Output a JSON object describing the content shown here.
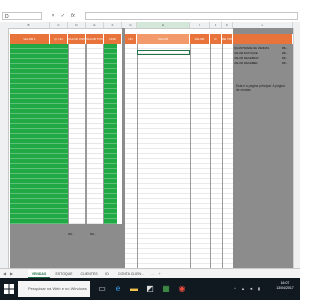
{
  "formula_bar": {
    "name_box": "D",
    "cancel": "×",
    "enter": "✓",
    "fx": "fx",
    "formula": ""
  },
  "column_headers": [
    "B",
    "C",
    "D",
    "E",
    "F",
    "G",
    "H",
    "I",
    "J",
    "K",
    "L"
  ],
  "left_headers": [
    "VALOR 1",
    "Q. UN",
    "VALOR UNIT",
    "VALOR TOTAL",
    "UND"
  ],
  "right_headers": [
    "UN",
    "VALOR",
    "VALOR",
    "D",
    "DE TOTAL"
  ],
  "totals_row": {
    "left": "R$ -",
    "right": "R$ -"
  },
  "info_panel": [
    {
      "label": "QUANTIDADE DE VENDAS",
      "value": "R$ -"
    },
    {
      "label": "VALOR ESTOQUE",
      "value": "R$ -"
    },
    {
      "label": "VALOR RECEBIDO",
      "value": "R$ -"
    },
    {
      "label": "VALOR RECEBER",
      "value": "R$ -"
    }
  ],
  "note": "Esta é a página principal. A página de vendas",
  "sheet_tabs": [
    "VENDAS",
    "ESTOQUE",
    "CLIENTES",
    "ID",
    "CONTA CLIEN..."
  ],
  "tab_nav": {
    "prev": "◀",
    "next": "▶",
    "more": "...",
    "add": "+"
  },
  "taskbar": {
    "search_placeholder": "Pesquisar na Web e no Windows",
    "clock_time": "16:07",
    "clock_date": "13/04/2017"
  }
}
